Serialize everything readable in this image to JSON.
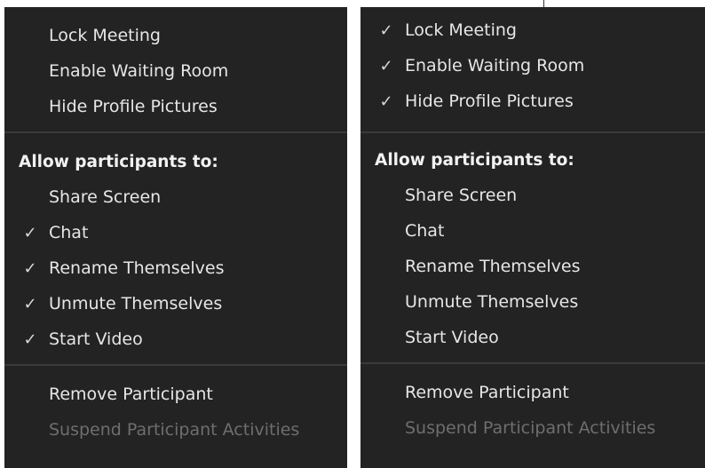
{
  "left_menu": {
    "top_items": [
      {
        "label": "Lock Meeting",
        "checked": false
      },
      {
        "label": "Enable Waiting Room",
        "checked": false
      },
      {
        "label": "Hide Profile Pictures",
        "checked": false
      }
    ],
    "heading": "Allow participants to:",
    "allow_items": [
      {
        "label": "Share Screen",
        "checked": false
      },
      {
        "label": "Chat",
        "checked": true
      },
      {
        "label": "Rename Themselves",
        "checked": true
      },
      {
        "label": "Unmute Themselves",
        "checked": true
      },
      {
        "label": "Start Video",
        "checked": true
      }
    ],
    "bottom_items": [
      {
        "label": "Remove Participant",
        "disabled": false
      },
      {
        "label": "Suspend Participant Activities",
        "disabled": true
      }
    ]
  },
  "right_menu": {
    "top_items": [
      {
        "label": "Lock Meeting",
        "checked": true
      },
      {
        "label": "Enable Waiting Room",
        "checked": true
      },
      {
        "label": "Hide Profile Pictures",
        "checked": true
      }
    ],
    "heading": "Allow participants to:",
    "allow_items": [
      {
        "label": "Share Screen",
        "checked": false
      },
      {
        "label": "Chat",
        "checked": false
      },
      {
        "label": "Rename Themselves",
        "checked": false
      },
      {
        "label": "Unmute Themselves",
        "checked": false
      },
      {
        "label": "Start Video",
        "checked": false
      }
    ],
    "bottom_items": [
      {
        "label": "Remove Participant",
        "disabled": false
      },
      {
        "label": "Suspend Participant Activities",
        "disabled": true
      }
    ]
  },
  "icons": {
    "check": "✓"
  },
  "colors": {
    "menu_bg": "#232323",
    "text": "#e6e6e6",
    "disabled_text": "#6e6e6e",
    "divider": "#3a3a3a"
  }
}
